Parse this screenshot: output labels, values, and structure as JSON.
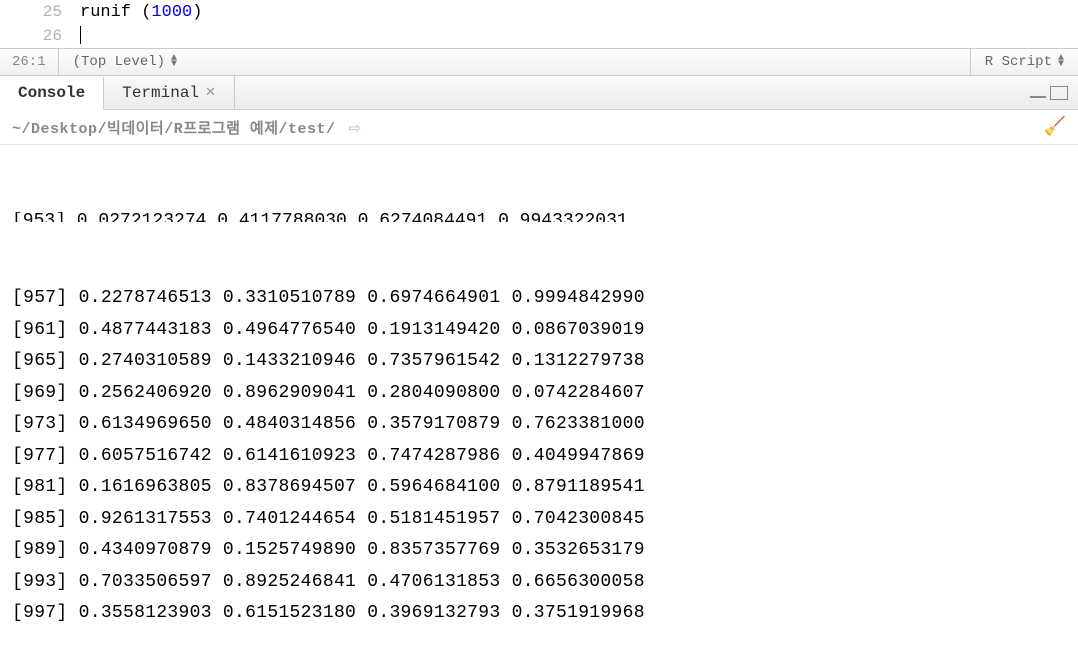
{
  "editor": {
    "lines": [
      {
        "number": "25",
        "func": "runif",
        "open": " (",
        "arg": "1000",
        "close": ")"
      },
      {
        "number": "26",
        "func": "",
        "open": "",
        "arg": "",
        "close": ""
      }
    ]
  },
  "statusbar": {
    "cursor_position": "26:1",
    "scope_label": "(Top Level)",
    "language_label": "R Script"
  },
  "panel": {
    "tabs": {
      "console": "Console",
      "terminal": "Terminal"
    },
    "console_path": "~/Desktop/빅데이터/R프로그램 예제/test/",
    "clipped_line": "[953] 0.0272123274 0.4117788030 0.6274084491 0.9943322031",
    "output_rows": [
      {
        "idx": "[957]",
        "v1": "0.2278746513",
        "v2": "0.3310510789",
        "v3": "0.6974664901",
        "v4": "0.9994842990"
      },
      {
        "idx": "[961]",
        "v1": "0.4877443183",
        "v2": "0.4964776540",
        "v3": "0.1913149420",
        "v4": "0.0867039019"
      },
      {
        "idx": "[965]",
        "v1": "0.2740310589",
        "v2": "0.1433210946",
        "v3": "0.7357961542",
        "v4": "0.1312279738"
      },
      {
        "idx": "[969]",
        "v1": "0.2562406920",
        "v2": "0.8962909041",
        "v3": "0.2804090800",
        "v4": "0.0742284607"
      },
      {
        "idx": "[973]",
        "v1": "0.6134969650",
        "v2": "0.4840314856",
        "v3": "0.3579170879",
        "v4": "0.7623381000"
      },
      {
        "idx": "[977]",
        "v1": "0.6057516742",
        "v2": "0.6141610923",
        "v3": "0.7474287986",
        "v4": "0.4049947869"
      },
      {
        "idx": "[981]",
        "v1": "0.1616963805",
        "v2": "0.8378694507",
        "v3": "0.5964684100",
        "v4": "0.8791189541"
      },
      {
        "idx": "[985]",
        "v1": "0.9261317553",
        "v2": "0.7401244654",
        "v3": "0.5181451957",
        "v4": "0.7042300845"
      },
      {
        "idx": "[989]",
        "v1": "0.4340970879",
        "v2": "0.1525749890",
        "v3": "0.8357357769",
        "v4": "0.3532653179"
      },
      {
        "idx": "[993]",
        "v1": "0.7033506597",
        "v2": "0.8925246841",
        "v3": "0.4706131853",
        "v4": "0.6656300058"
      },
      {
        "idx": "[997]",
        "v1": "0.3558123903",
        "v2": "0.6151523180",
        "v3": "0.3969132793",
        "v4": "0.3751919968"
      }
    ]
  }
}
